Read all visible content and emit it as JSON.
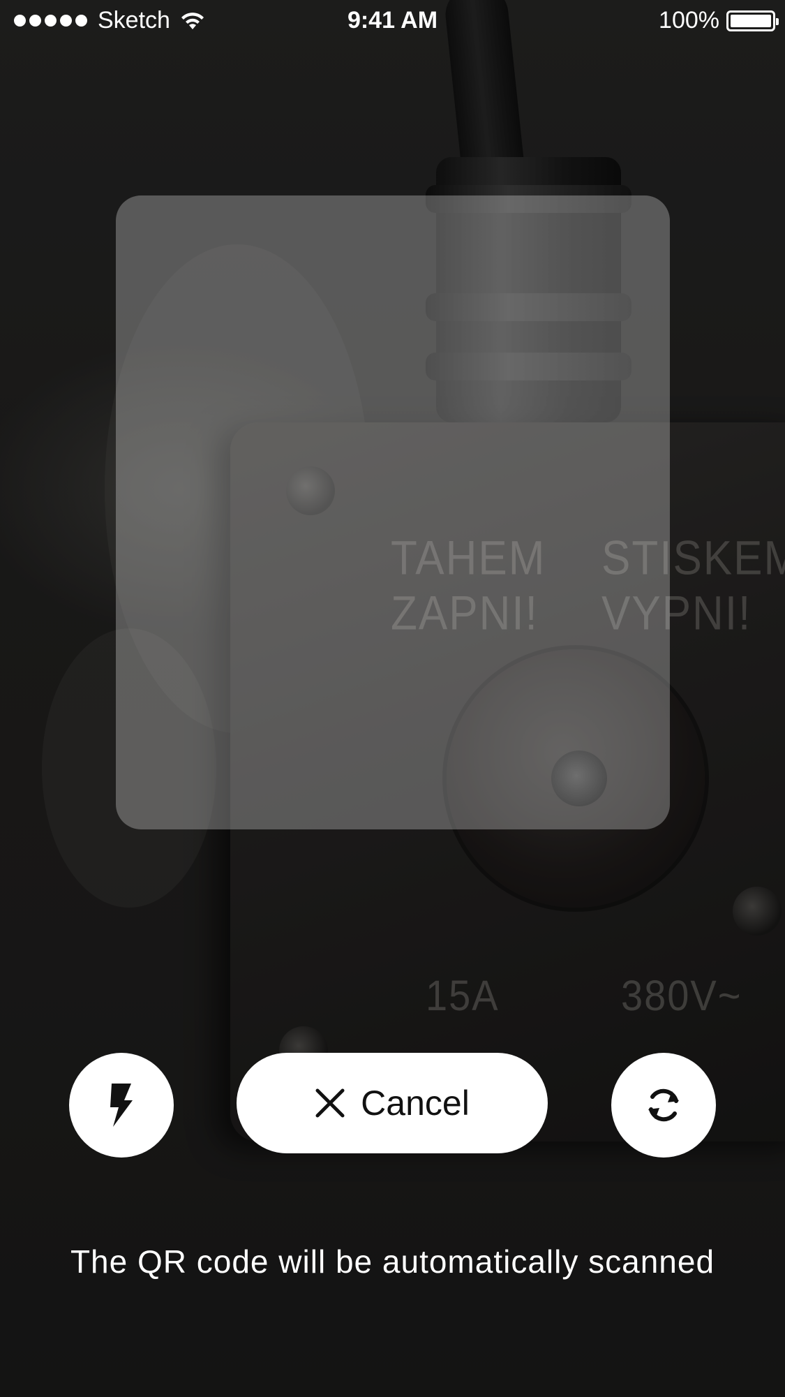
{
  "status_bar": {
    "carrier": "Sketch",
    "time": "9:41 AM",
    "battery": "100%",
    "signal_bars": 5,
    "icons": [
      "signal-dots-icon",
      "wifi-icon",
      "battery-icon"
    ]
  },
  "scanner": {
    "hint": "The QR code will be automatically scanned"
  },
  "controls": {
    "flash_icon": "flash-icon",
    "cancel_label": "Cancel",
    "cancel_icon": "close-icon",
    "switch_icon": "switch-camera-icon"
  },
  "colors": {
    "button_bg": "#ffffff",
    "button_fg": "#111111",
    "text": "#ffffff",
    "scan_window": "rgba(255,255,255,0.28)"
  }
}
